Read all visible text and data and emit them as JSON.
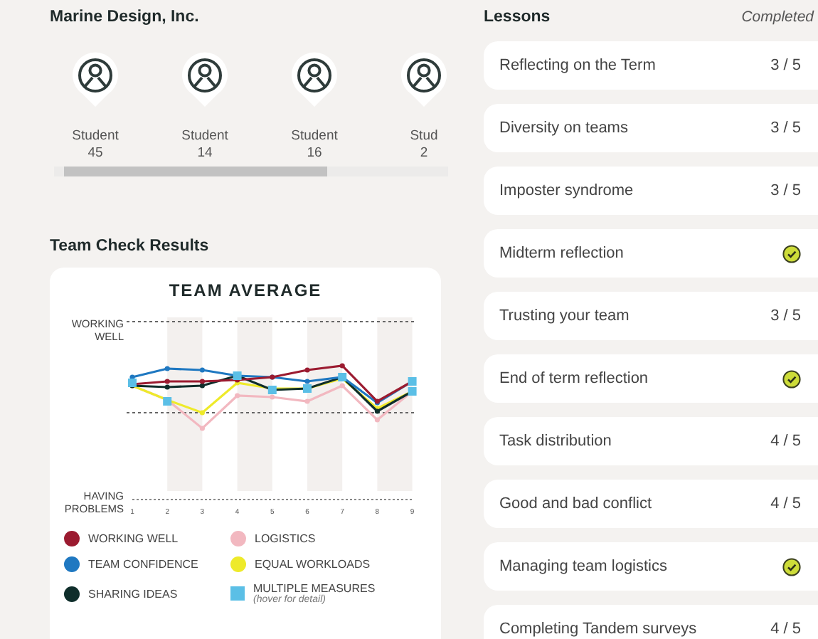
{
  "team": {
    "name": "Marine Design, Inc.",
    "students": [
      {
        "label": "Student",
        "number": "45"
      },
      {
        "label": "Student",
        "number": "14"
      },
      {
        "label": "Student",
        "number": "16"
      },
      {
        "label": "Stud",
        "number": "2"
      }
    ]
  },
  "team_check": {
    "heading": "Team Check Results",
    "chart_title": "TEAM AVERAGE",
    "y_top_label": "WORKING WELL",
    "y_bottom_label": "HAVING PROBLEMS",
    "x_ticks": [
      "1",
      "2",
      "3",
      "4",
      "5",
      "6",
      "7",
      "8",
      "9"
    ],
    "legend": [
      {
        "kind": "dot",
        "label": "WORKING WELL",
        "color": "#9b1b30"
      },
      {
        "kind": "dot",
        "label": "LOGISTICS",
        "color": "#f2b8c0"
      },
      {
        "kind": "dot",
        "label": "TEAM CONFIDENCE",
        "color": "#1f78c1"
      },
      {
        "kind": "dot",
        "label": "EQUAL WORKLOADS",
        "color": "#eeea2a"
      },
      {
        "kind": "dot",
        "label": "SHARING IDEAS",
        "color": "#0f2e2b"
      },
      {
        "kind": "square",
        "label": "MULTIPLE MEASURES",
        "note": "(hover for detail)",
        "color": "#5bbfe6"
      }
    ]
  },
  "lessons": {
    "heading": "Lessons",
    "status_heading": "Completed",
    "rows": [
      {
        "title": "Reflecting on the Term",
        "completed": false,
        "progress": "3 / 5"
      },
      {
        "title": "Diversity on teams",
        "completed": false,
        "progress": "3 / 5"
      },
      {
        "title": "Imposter syndrome",
        "completed": false,
        "progress": "3 / 5"
      },
      {
        "title": "Midterm reflection",
        "completed": true
      },
      {
        "title": "Trusting your team",
        "completed": false,
        "progress": "3 / 5"
      },
      {
        "title": "End of term reflection",
        "completed": true
      },
      {
        "title": "Task distribution",
        "completed": false,
        "progress": "4 / 5"
      },
      {
        "title": "Good and bad conflict",
        "completed": false,
        "progress": "4 / 5"
      },
      {
        "title": "Managing team logistics",
        "completed": true
      },
      {
        "title": "Completing Tandem surveys",
        "completed": false,
        "progress": "4 / 5"
      }
    ]
  }
}
